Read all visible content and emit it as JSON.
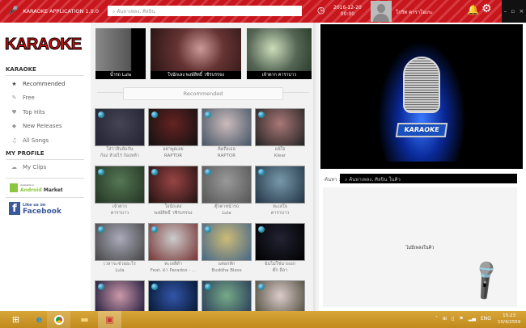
{
  "titlebar": {
    "app_name": "KARAOKE APPLICATION 1.0.0",
    "search_placeholder": "ค้นหาเพลง, ศิลปิน",
    "date": "2016-12-20",
    "time": "00:00",
    "user_name": "โกวิท คาราโอเกะ",
    "window_controls": [
      "–",
      "▫",
      "×"
    ]
  },
  "sidebar": {
    "logo": "KARAOKE",
    "section_karaoke": "KARAOKE",
    "items": [
      {
        "label": "Recommended",
        "icon": "star-icon"
      },
      {
        "label": "Free",
        "icon": "microphone-icon"
      },
      {
        "label": "Top Hits",
        "icon": "heart-icon"
      },
      {
        "label": "New Releases",
        "icon": "tag-icon"
      },
      {
        "label": "All Songs",
        "icon": "music-note-icon"
      }
    ],
    "section_profile": "MY PROFILE",
    "profile_items": [
      {
        "label": "My Clips",
        "icon": "cloud-icon"
      }
    ],
    "android": {
      "small": "Available in",
      "brand": "Android",
      "market": "Market"
    },
    "facebook": {
      "like": "Like us on",
      "name": "Facebook"
    }
  },
  "carousel": [
    {
      "caption": "น้ำรถ Lula"
    },
    {
      "caption": "ใจนักเลง พงษ์สิทธิ์ วชิรบรรจง"
    },
    {
      "caption": "เจ้าตาก คาราบาว"
    }
  ],
  "main": {
    "recommended_label": "Recommended",
    "songs": [
      {
        "title": "ใส่ว่าสิบอับกัน",
        "artist": "ก้อง ห้วยไร่ ก้องหล้า"
      },
      {
        "title": "อย่าพูดเลย",
        "artist": "RAPTOR"
      },
      {
        "title": "คิดถึงเธอ",
        "artist": "RAPTOR"
      },
      {
        "title": "แพ้ใจ",
        "artist": "Klear"
      },
      {
        "title": "เจ้าตาก",
        "artist": "คาราบาว"
      },
      {
        "title": "ใจนักเลง",
        "artist": "พงษ์สิทธิ์ วชิรบรรจง"
      },
      {
        "title": "ตุ๊กตาหน้ารถ",
        "artist": "Lula"
      },
      {
        "title": "ทะเลใจ",
        "artist": "คาราบาว"
      },
      {
        "title": "เวลาจะช่วยอะไร",
        "artist": "Lula"
      },
      {
        "title": "ทะเลสีดำ",
        "artist": "Feat. ดา Paradox - ..."
      },
      {
        "title": "แค่อกหัก",
        "artist": "Buddha Bless"
      },
      {
        "title": "ฉันไม่ใช่นางเอก",
        "artist": "ตั๊ก ลีลา"
      },
      {
        "title": "",
        "artist": ""
      },
      {
        "title": "",
        "artist": ""
      },
      {
        "title": "",
        "artist": ""
      },
      {
        "title": "",
        "artist": ""
      }
    ]
  },
  "player": {
    "badge": "KARAOKE",
    "search_label": "ค้นหา :",
    "search_placeholder": "ค้นหาเพลง, ศิลปิน ในคิว",
    "queue_empty": "ไม่มีเพลงในคิว"
  },
  "taskbar": {
    "lang": "ENG",
    "time": "15:23",
    "date": "10/4/2559"
  }
}
